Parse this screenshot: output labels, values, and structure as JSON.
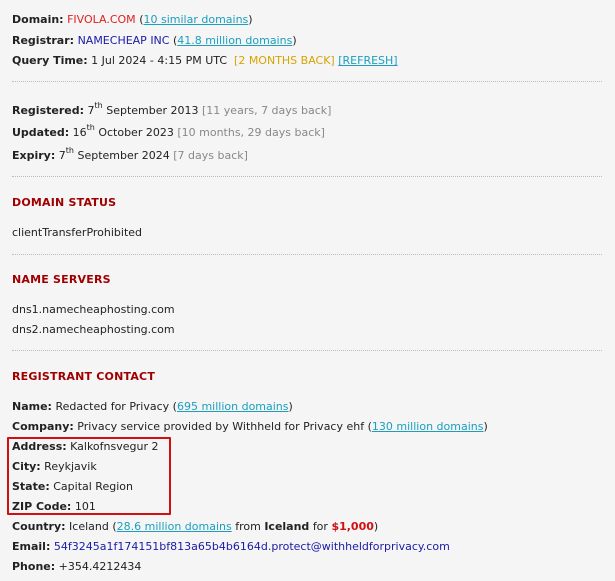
{
  "domain": {
    "label": "Domain:",
    "value": "FIVOLA.COM",
    "link": "10 similar domains",
    "open": "(",
    "close": ")"
  },
  "registrar": {
    "label": "Registrar:",
    "value": "NAMECHEAP INC",
    "link": "41.8 million domains",
    "open": "(",
    "close": ")"
  },
  "query": {
    "label": "Query Time:",
    "value": "1 Jul 2024 - 4:15 PM UTC",
    "ago": "[2 MONTHS BACK]",
    "refresh": "[REFRESH]"
  },
  "dates": {
    "registered": {
      "label": "Registered:",
      "day": "7",
      "suffix": "th",
      "rest": "September 2013",
      "ago": "[11 years, 7 days back]"
    },
    "updated": {
      "label": "Updated:",
      "day": "16",
      "suffix": "th",
      "rest": "October 2023",
      "ago": "[10 months, 29 days back]"
    },
    "expiry": {
      "label": "Expiry:",
      "day": "7",
      "suffix": "th",
      "rest": "September 2024",
      "ago": "[7 days back]"
    }
  },
  "status": {
    "heading": "DOMAIN STATUS",
    "items": [
      "clientTransferProhibited"
    ]
  },
  "nameservers": {
    "heading": "NAME SERVERS",
    "items": [
      "dns1.namecheaphosting.com",
      "dns2.namecheaphosting.com"
    ]
  },
  "registrant": {
    "heading": "REGISTRANT CONTACT",
    "name": {
      "label": "Name:",
      "value": "Redacted for Privacy",
      "link": "695 million domains"
    },
    "company": {
      "label": "Company:",
      "value": "Privacy service provided by Withheld for Privacy ehf",
      "link": "130 million domains"
    },
    "address": {
      "label": "Address:",
      "value": "Kalkofnsvegur 2"
    },
    "city": {
      "label": "City:",
      "value": "Reykjavik"
    },
    "state": {
      "label": "State:",
      "value": "Capital Region"
    },
    "zip": {
      "label": "ZIP Code:",
      "value": "101"
    },
    "country": {
      "label": "Country:",
      "value": "Iceland",
      "link": "28.6 million domains",
      "from": "from",
      "place": "Iceland",
      "for": "for",
      "price": "$1,000"
    },
    "email": {
      "label": "Email:",
      "value": "54f3245a1f174151bf813a65b4b6164d.protect@withheldforprivacy.com"
    },
    "phone": {
      "label": "Phone:",
      "value": "+354.4212434"
    }
  },
  "colors": {
    "highlight": "#d01010",
    "heading": "#a00000",
    "link": "#1a9fbf"
  }
}
